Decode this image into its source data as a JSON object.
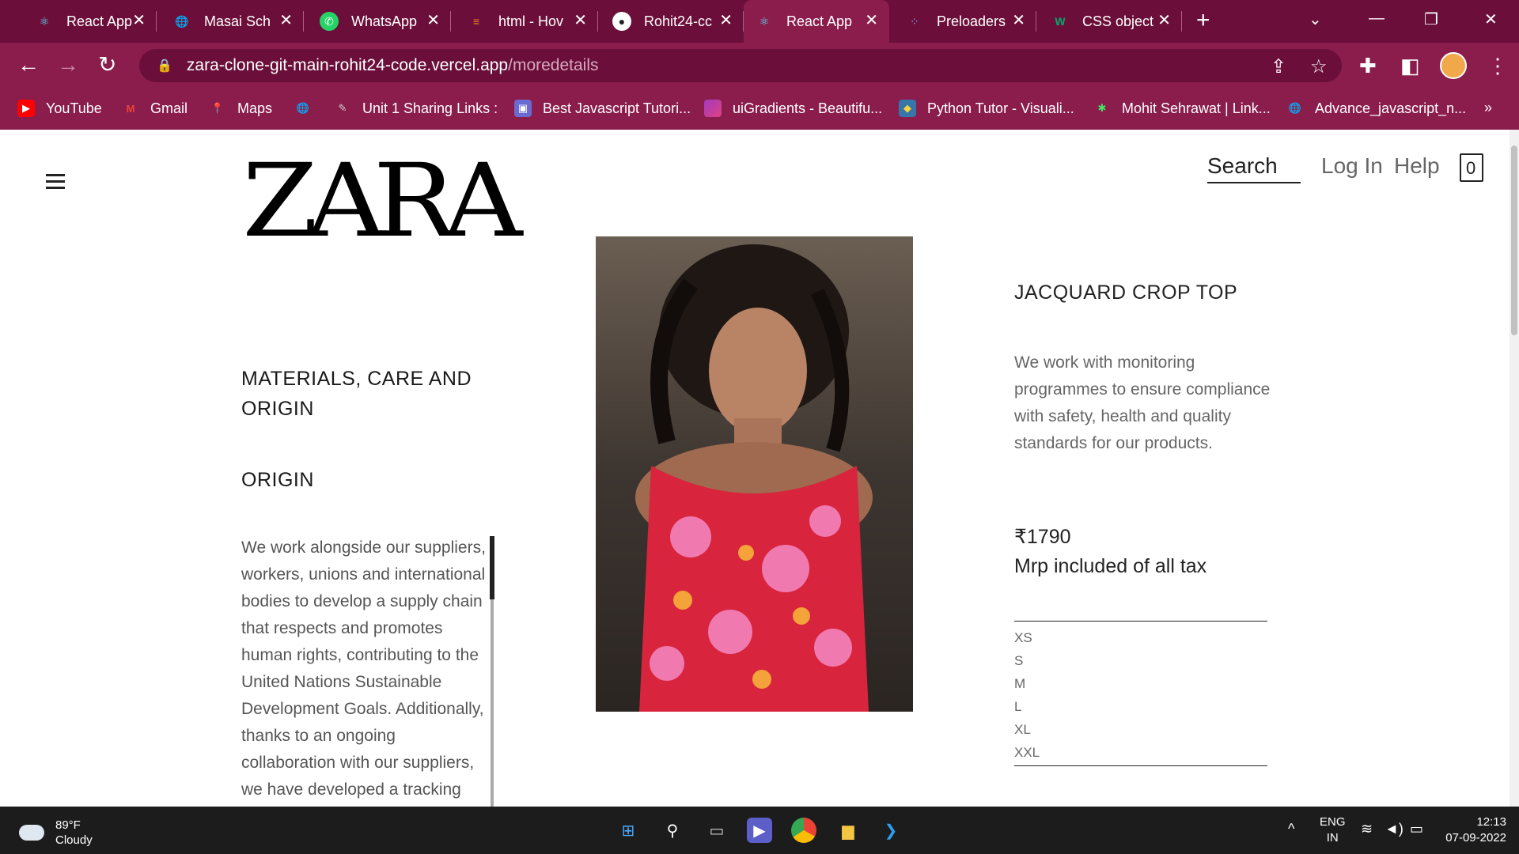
{
  "browser": {
    "tabs": [
      {
        "label": "React App",
        "icon": "react-icon",
        "color": "#61dafb"
      },
      {
        "label": "Masai Sch",
        "icon": "globe-icon",
        "color": "#ffffff"
      },
      {
        "label": "WhatsApp",
        "icon": "whatsapp-icon",
        "color": "#25d366"
      },
      {
        "label": "html - Hov",
        "icon": "stackoverflow-icon",
        "color": "#f48024"
      },
      {
        "label": "Rohit24-cc",
        "icon": "github-icon",
        "color": "#ffffff"
      },
      {
        "label": "React App",
        "icon": "react-icon",
        "color": "#61dafb"
      },
      {
        "label": "Preloaders",
        "icon": "preloader-icon",
        "color": "#7aa7ff"
      },
      {
        "label": "CSS object",
        "icon": "w3schools-icon",
        "color": "#04aa6d"
      }
    ],
    "active_tab_index": 5,
    "url_host": "zara-clone-git-main-rohit24-code.vercel.app",
    "url_path": "/moredetails",
    "bookmarks": [
      {
        "label": "YouTube",
        "icon": "youtube-icon",
        "color": "#ff0000"
      },
      {
        "label": "Gmail",
        "icon": "gmail-icon",
        "color": "#ea4335"
      },
      {
        "label": "Maps",
        "icon": "maps-icon",
        "color": "#34a853"
      },
      {
        "label": "",
        "icon": "globe-icon",
        "color": "#ffffff"
      },
      {
        "label": "Unit 1 Sharing Links :",
        "icon": "pen-icon",
        "color": "#cccccc"
      },
      {
        "label": "Best Javascript Tutori...",
        "icon": "site-icon",
        "color": "#6a6ad0"
      },
      {
        "label": "uiGradients - Beautifu...",
        "icon": "gradient-icon",
        "color": "#a03cc0"
      },
      {
        "label": "Python Tutor - Visuali...",
        "icon": "python-icon",
        "color": "#3776ab"
      },
      {
        "label": "Mohit Sehrawat | Link...",
        "icon": "linktree-icon",
        "color": "#43e660"
      },
      {
        "label": "Advance_javascript_n...",
        "icon": "globe-icon",
        "color": "#ffffff"
      }
    ],
    "bookmarks_overflow": "»"
  },
  "page": {
    "logo": "ZARA",
    "nav": {
      "search": "Search",
      "login": "Log In",
      "help": "Help",
      "bag_count": "0"
    },
    "materials_heading_line1": "MATERIALS, CARE AND",
    "materials_heading_line2": "ORIGIN",
    "origin_heading": "ORIGIN",
    "origin_text": "We work alongside our suppliers, workers, unions and international bodies to develop a supply chain that respects and promotes human rights, contributing to the United Nations Sustainable Development Goals. Additionally, thanks to an ongoing collaboration with our suppliers, we have developed a tracking",
    "product_title": "JACQUARD CROP TOP",
    "product_desc": "We work with monitoring programmes to ensure compliance with safety, health and quality standards for our products.",
    "price": "₹1790",
    "tax_note": "Mrp included of all tax",
    "sizes": [
      "XS",
      "S",
      "M",
      "L",
      "XL",
      "XXL"
    ]
  },
  "taskbar": {
    "temperature": "89°F",
    "weather": "Cloudy",
    "lang_line1": "ENG",
    "lang_line2": "IN",
    "time": "12:13",
    "date": "07-09-2022"
  },
  "colors": {
    "tab_strip": "#6b0f3a",
    "toolbar": "#8b1d4d",
    "taskbar": "#1c1c1c"
  }
}
